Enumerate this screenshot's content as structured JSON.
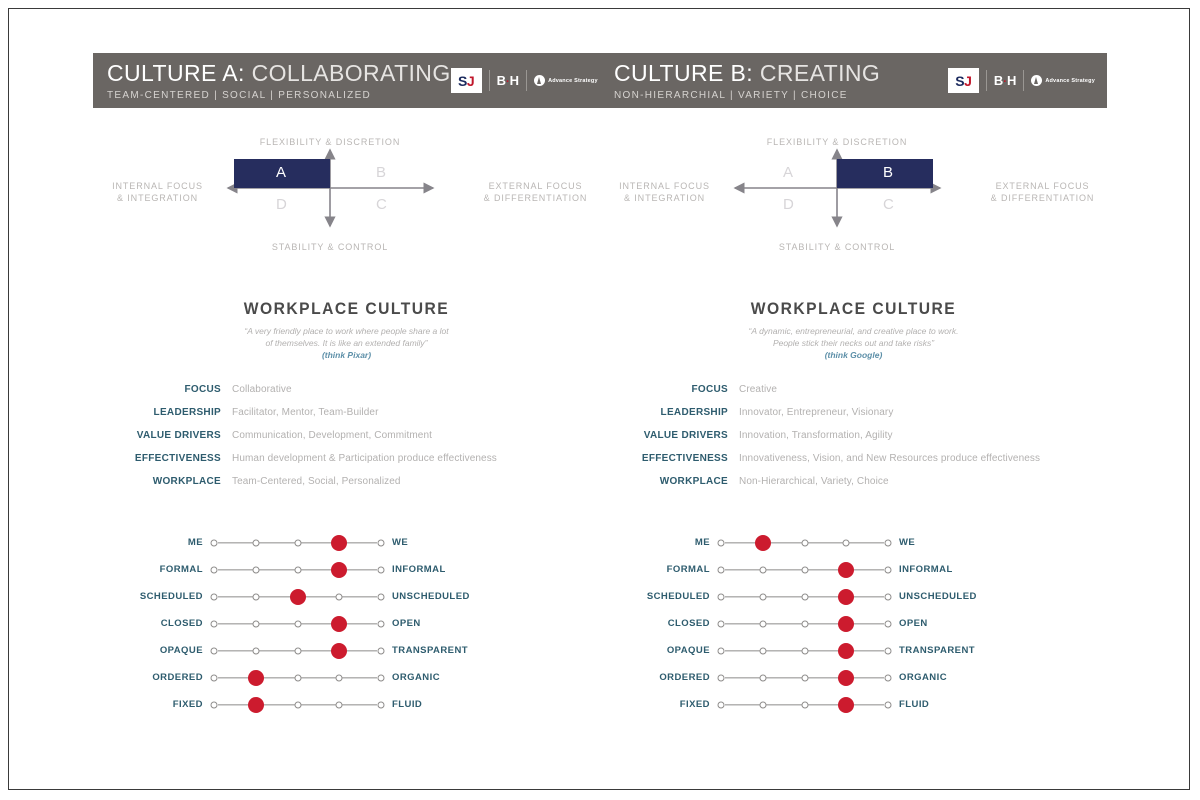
{
  "brand": {
    "logo_sj_s": "SJ",
    "logo_sj_j": "J",
    "logo_bh": "B",
    "logo_bh_dot": "·",
    "logo_bh_h": "H",
    "logo_advance": "Advance Strategy"
  },
  "quadrant_labels": {
    "top": "FLEXIBILITY & DISCRETION",
    "bottom": "STABILITY & CONTROL",
    "left": "INTERNAL FOCUS\n& INTEGRATION",
    "left_line1": "INTERNAL FOCUS",
    "left_line2": "& INTEGRATION",
    "right_line1": "EXTERNAL FOCUS",
    "right_line2": "& DIFFERENTIATION",
    "a": "A",
    "b": "B",
    "c": "C",
    "d": "D"
  },
  "colors": {
    "header_bar": "#6a6663",
    "navy_block": "#262d5e",
    "slider_red": "#cc1b2e",
    "label_teal": "#2e5c6e",
    "value_gray": "#b3b1b0",
    "think_blue": "#5c8fa8"
  },
  "cultures": [
    {
      "header": {
        "culture_label": "CULTURE A:",
        "culture_name": "COLLABORATING",
        "subtitle": "TEAM-CENTERED  |  SOCIAL  |  PERSONALIZED"
      },
      "quadrant": {
        "active": "A"
      },
      "workplace": {
        "title": "WORKPLACE CULTURE",
        "quote_line1": "“A very friendly place to work where people share a lot",
        "quote_line2": "of themselves. It is like an extended family”",
        "think": "(think Pixar)"
      },
      "attributes": [
        {
          "label": "FOCUS",
          "value": "Collaborative"
        },
        {
          "label": "LEADERSHIP",
          "value": "Facilitator, Mentor, Team-Builder"
        },
        {
          "label": "VALUE DRIVERS",
          "value": "Communication, Development, Commitment"
        },
        {
          "label": "EFFECTIVENESS",
          "value": "Human development & Participation produce effectiveness"
        },
        {
          "label": "WORKPLACE",
          "value": "Team-Centered, Social, Personalized"
        }
      ],
      "sliders": [
        {
          "left": "ME",
          "right": "WE",
          "positions": 5,
          "selected": 4
        },
        {
          "left": "FORMAL",
          "right": "INFORMAL",
          "positions": 5,
          "selected": 4
        },
        {
          "left": "SCHEDULED",
          "right": "UNSCHEDULED",
          "positions": 5,
          "selected": 3
        },
        {
          "left": "CLOSED",
          "right": "OPEN",
          "positions": 5,
          "selected": 4
        },
        {
          "left": "OPAQUE",
          "right": "TRANSPARENT",
          "positions": 5,
          "selected": 4
        },
        {
          "left": "ORDERED",
          "right": "ORGANIC",
          "positions": 5,
          "selected": 2
        },
        {
          "left": "FIXED",
          "right": "FLUID",
          "positions": 5,
          "selected": 2
        }
      ]
    },
    {
      "header": {
        "culture_label": "CULTURE B:",
        "culture_name": "CREATING",
        "subtitle": "NON-HIERARCHIAL  |  VARIETY  |  CHOICE"
      },
      "quadrant": {
        "active": "B"
      },
      "workplace": {
        "title": "WORKPLACE CULTURE",
        "quote_line1": "“A dynamic, entrepreneurial, and creative place to work.",
        "quote_line2": "People stick their necks out and take risks”",
        "think": "(think Google)"
      },
      "attributes": [
        {
          "label": "FOCUS",
          "value": "Creative"
        },
        {
          "label": "LEADERSHIP",
          "value": "Innovator, Entrepreneur, Visionary"
        },
        {
          "label": "VALUE DRIVERS",
          "value": "Innovation, Transformation, Agility"
        },
        {
          "label": "EFFECTIVENESS",
          "value": "Innovativeness, Vision, and New Resources produce effectiveness"
        },
        {
          "label": "WORKPLACE",
          "value": "Non-Hierarchical, Variety, Choice"
        }
      ],
      "sliders": [
        {
          "left": "ME",
          "right": "WE",
          "positions": 5,
          "selected": 2
        },
        {
          "left": "FORMAL",
          "right": "INFORMAL",
          "positions": 5,
          "selected": 4
        },
        {
          "left": "SCHEDULED",
          "right": "UNSCHEDULED",
          "positions": 5,
          "selected": 4
        },
        {
          "left": "CLOSED",
          "right": "OPEN",
          "positions": 5,
          "selected": 4
        },
        {
          "left": "OPAQUE",
          "right": "TRANSPARENT",
          "positions": 5,
          "selected": 4
        },
        {
          "left": "ORDERED",
          "right": "ORGANIC",
          "positions": 5,
          "selected": 4
        },
        {
          "left": "FIXED",
          "right": "FLUID",
          "positions": 5,
          "selected": 4
        }
      ]
    }
  ]
}
